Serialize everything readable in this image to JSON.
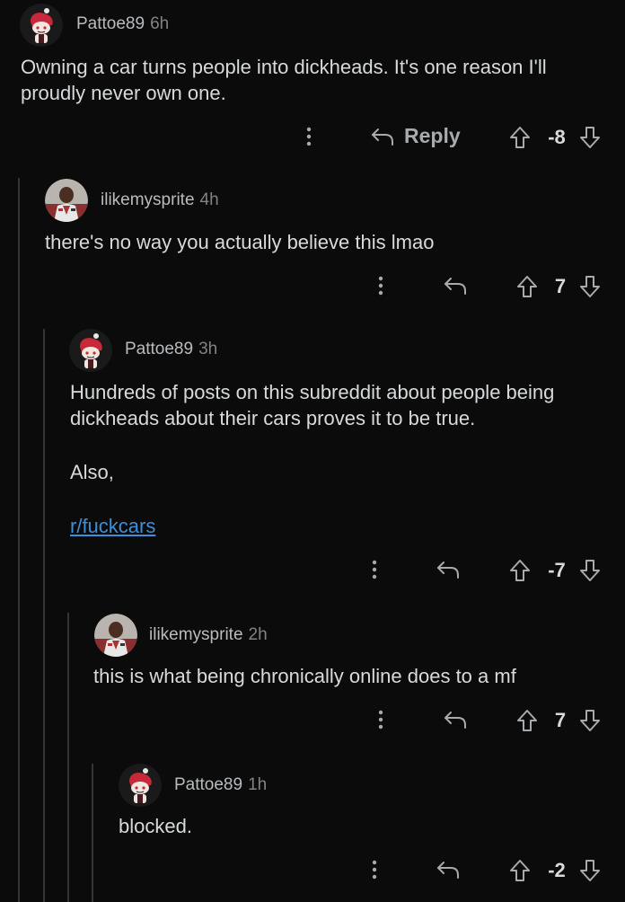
{
  "comments": [
    {
      "user": "Pattoe89",
      "time": "6h",
      "lines": [
        "Owning a car turns people into dickheads. It's one reason I'll",
        "proudly never own one."
      ],
      "reply_label": "Reply",
      "score": "-8"
    },
    {
      "user": "ilikemysprite",
      "time": "4h",
      "lines": [
        "there's no way you actually believe this lmao"
      ],
      "score": "7"
    },
    {
      "user": "Pattoe89",
      "time": "3h",
      "lines": [
        "Hundreds of posts on this subreddit about people being",
        "dickheads about their cars proves it to be true."
      ],
      "extra": "Also,",
      "link": "r/fuckcars",
      "score": "-7"
    },
    {
      "user": "ilikemysprite",
      "time": "2h",
      "lines": [
        "this is what being chronically online does to a mf"
      ],
      "score": "7"
    },
    {
      "user": "Pattoe89",
      "time": "1h",
      "lines": [
        "blocked."
      ],
      "score": "-2"
    }
  ],
  "icons": {
    "more": "vertical-dots-icon",
    "reply": "reply-arrow-icon",
    "upvote": "upvote-arrow-icon",
    "downvote": "downvote-arrow-icon"
  },
  "colors": {
    "background": "#0b0b0b",
    "text": "#d7dadc",
    "link": "#3d8fd9",
    "thread_line": "#343536"
  }
}
